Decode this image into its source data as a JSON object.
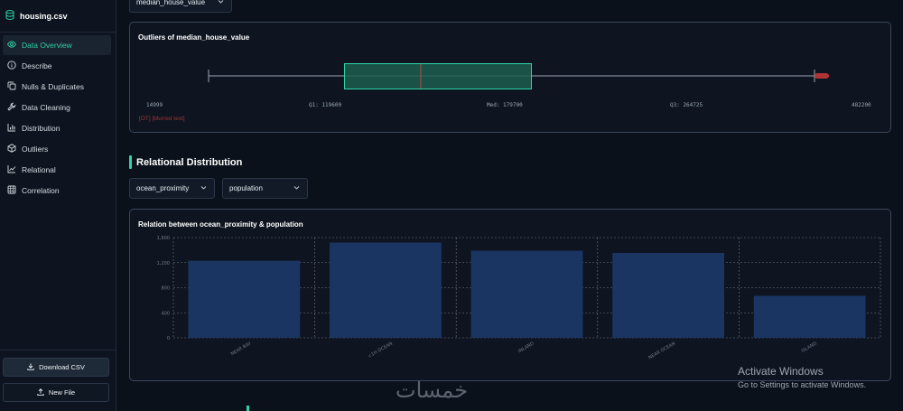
{
  "sidebar": {
    "file_name": "housing.csv",
    "items": [
      {
        "label": "Data Overview",
        "icon": "eye-icon",
        "active": true
      },
      {
        "label": "Describe",
        "icon": "info-circle-icon"
      },
      {
        "label": "Nulls & Duplicates",
        "icon": "copy-icon"
      },
      {
        "label": "Data Cleaning",
        "icon": "wrench-icon"
      },
      {
        "label": "Distribution",
        "icon": "bar-chart-icon"
      },
      {
        "label": "Outliers",
        "icon": "cube-icon"
      },
      {
        "label": "Relational",
        "icon": "trend-line-icon"
      },
      {
        "label": "Correlation",
        "icon": "grid-icon"
      }
    ],
    "download_label": "Download CSV",
    "new_file_label": "New File"
  },
  "outliers": {
    "column_select": "median_house_value",
    "title": "Outliers of median_house_value",
    "min_label": "14999",
    "q1_label": "Q1: 119600",
    "median_label": "Med: 179700",
    "q3_label": "Q3: 264725",
    "max_label": "482200",
    "note": "[OT] [blurred text]"
  },
  "relational": {
    "heading": "Relational Distribution",
    "x_select": "ocean_proximity",
    "y_select": "population"
  },
  "colors": {
    "accent": "#2fd3a5",
    "bar": "#1b3563",
    "outlier": "#a33232"
  },
  "chart_data": {
    "type": "bar",
    "title": "Relation between ocean_proximity & population",
    "categories": [
      "NEAR BAY",
      "<1H OCEAN",
      "INLAND",
      "NEAR OCEAN",
      "ISLAND"
    ],
    "values": [
      1230,
      1520,
      1390,
      1355,
      670
    ],
    "ylim": [
      0,
      1600
    ],
    "yticks": [
      "0",
      "400",
      "800",
      "1,200",
      "1,600"
    ],
    "grid": true,
    "xlabel": "",
    "ylabel": ""
  },
  "watermark": {
    "activate_title": "Activate Windows",
    "activate_sub": "Go to Settings to activate Windows.",
    "logo_text": "خمسات"
  }
}
